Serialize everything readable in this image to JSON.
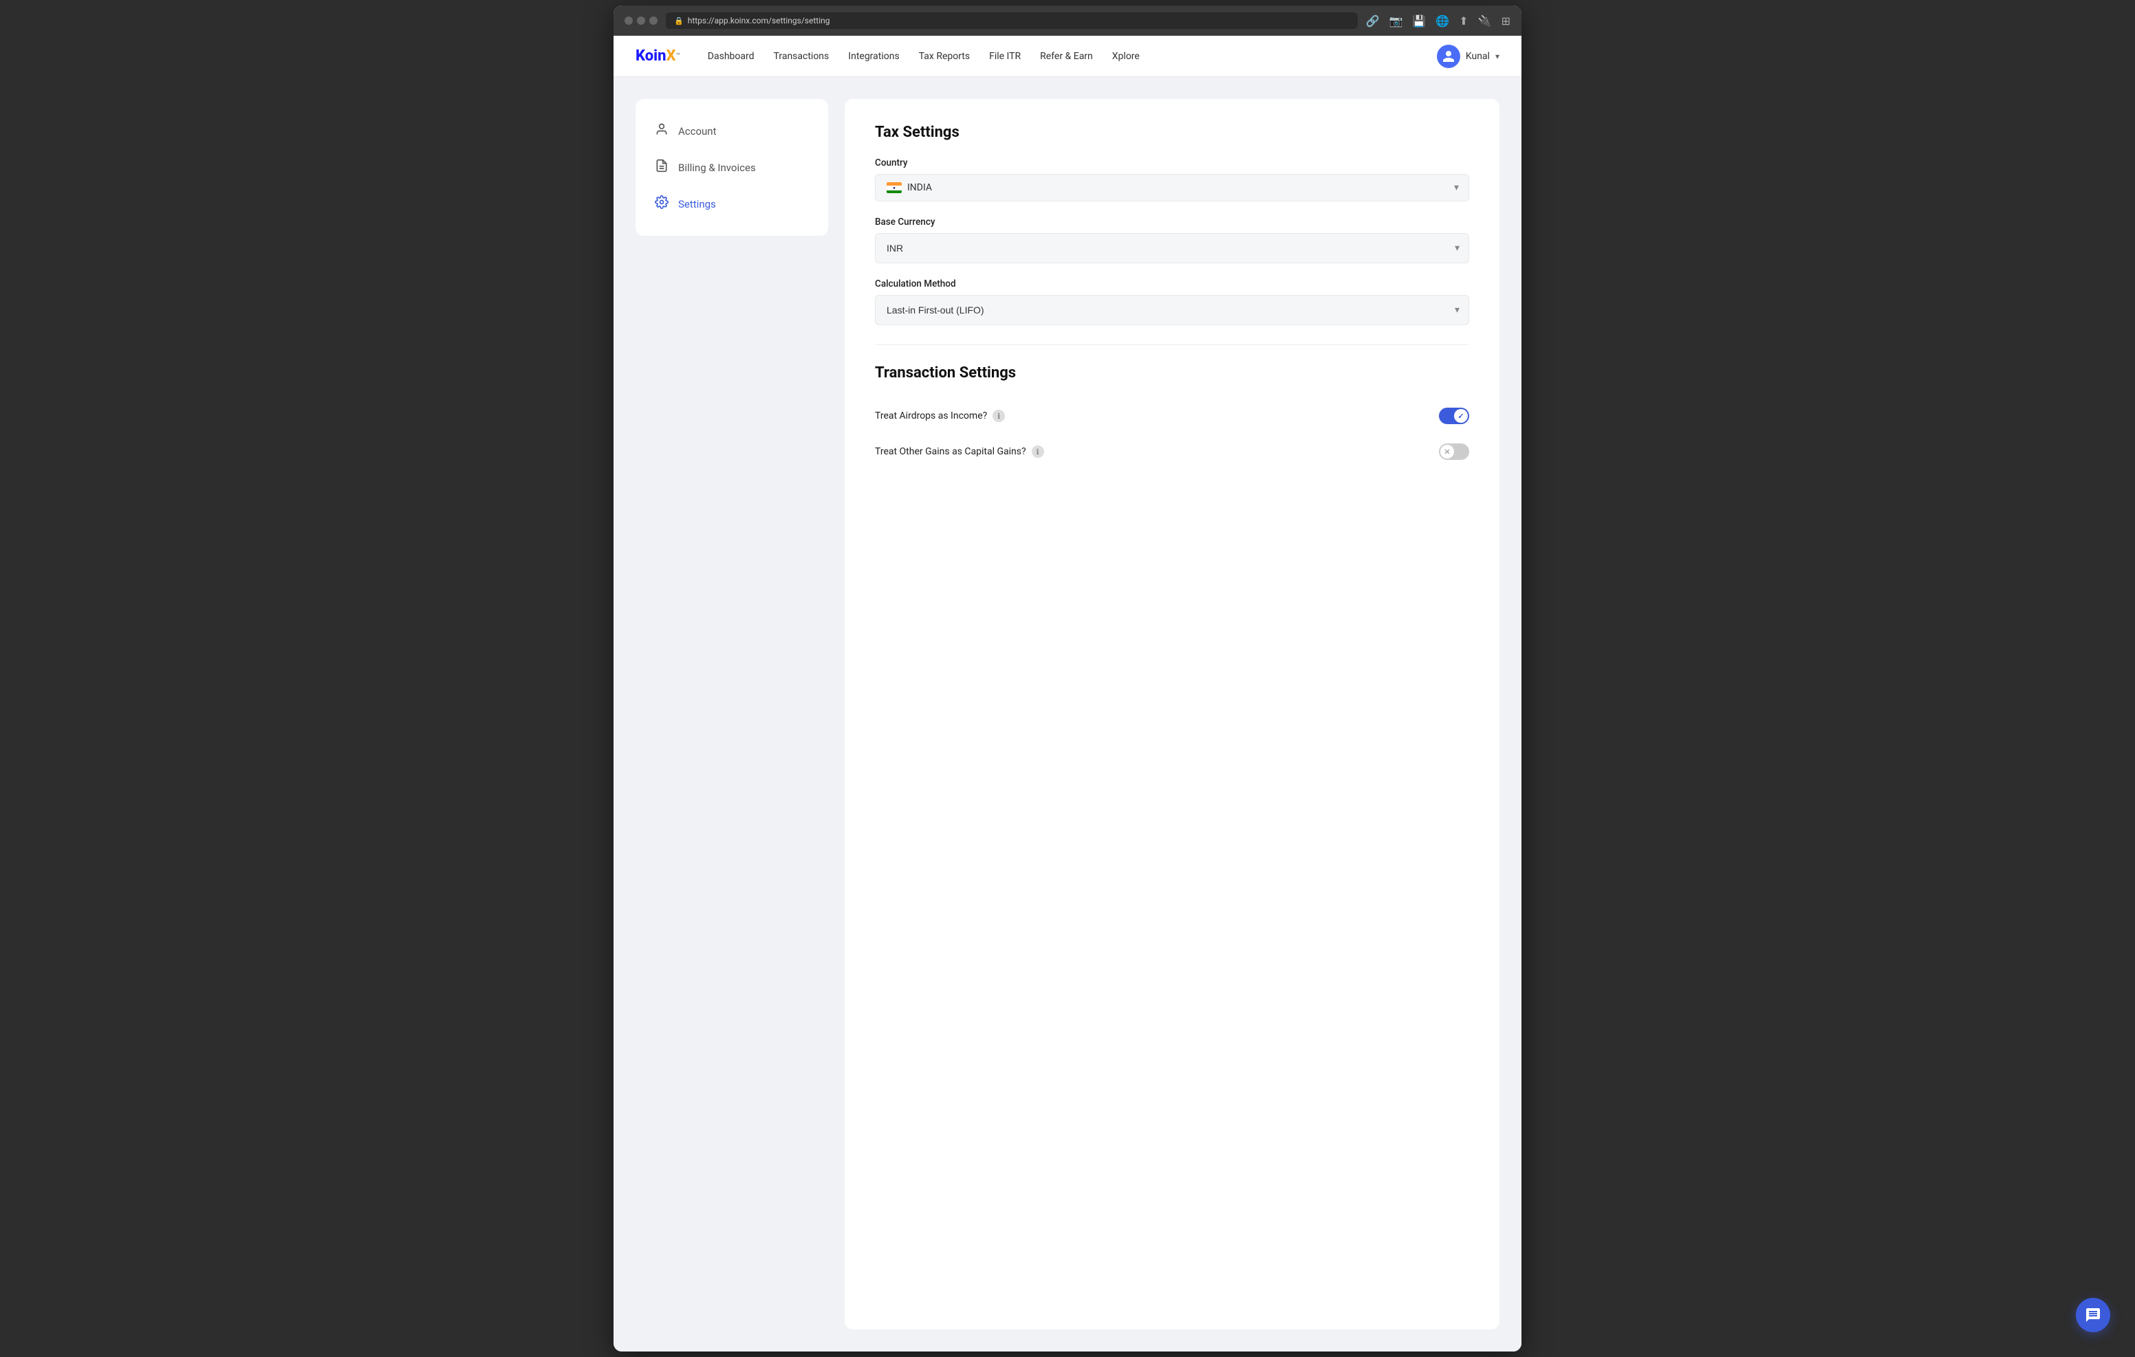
{
  "browser": {
    "url": "https://app.koinx.com/settings/setting",
    "lock_icon": "🔒"
  },
  "navbar": {
    "logo_koin": "Koin",
    "logo_x": "X",
    "logo_tm": "™",
    "links": [
      {
        "label": "Dashboard",
        "key": "dashboard"
      },
      {
        "label": "Transactions",
        "key": "transactions"
      },
      {
        "label": "Integrations",
        "key": "integrations"
      },
      {
        "label": "Tax Reports",
        "key": "tax-reports"
      },
      {
        "label": "File ITR",
        "key": "file-itr"
      },
      {
        "label": "Refer & Earn",
        "key": "refer-earn"
      },
      {
        "label": "Xplore",
        "key": "xplore"
      }
    ],
    "user_name": "Kunal"
  },
  "sidebar": {
    "items": [
      {
        "label": "Account",
        "icon": "👤",
        "key": "account",
        "active": false
      },
      {
        "label": "Billing & Invoices",
        "icon": "📄",
        "key": "billing",
        "active": false
      },
      {
        "label": "Settings",
        "icon": "⚙️",
        "key": "settings",
        "active": true
      }
    ]
  },
  "tax_settings": {
    "title": "Tax Settings",
    "country_label": "Country",
    "country_value": "INDIA",
    "base_currency_label": "Base Currency",
    "base_currency_value": "INR",
    "calculation_method_label": "Calculation Method",
    "calculation_method_value": "Last-in First-out (LIFO)"
  },
  "transaction_settings": {
    "title": "Transaction Settings",
    "toggles": [
      {
        "label": "Treat Airdrops as Income?",
        "key": "airdrops",
        "on": true
      },
      {
        "label": "Treat Other Gains as Capital Gains?",
        "key": "other-gains",
        "on": false
      }
    ]
  },
  "chat_button": {
    "icon": "💬"
  }
}
